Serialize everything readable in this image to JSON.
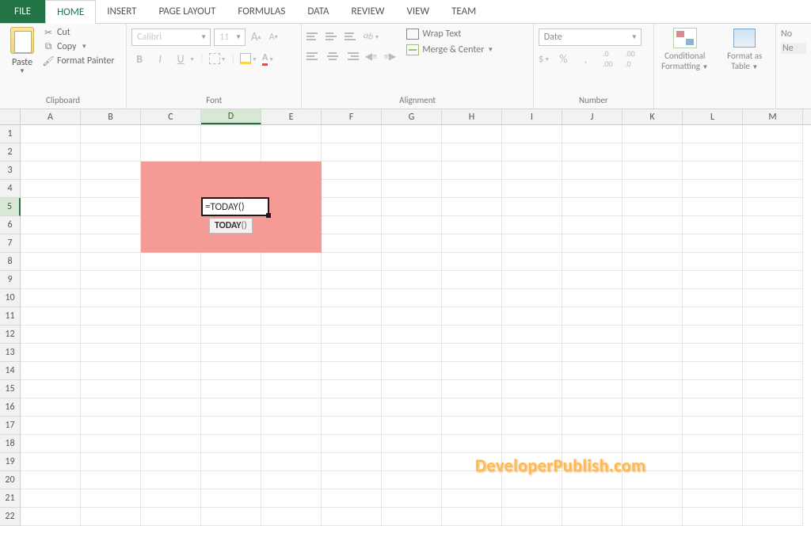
{
  "tabs": {
    "file": "FILE",
    "items": [
      "HOME",
      "INSERT",
      "PAGE LAYOUT",
      "FORMULAS",
      "DATA",
      "REVIEW",
      "VIEW",
      "TEAM"
    ],
    "active": "HOME"
  },
  "clipboard": {
    "group_label": "Clipboard",
    "paste": "Paste",
    "cut": "Cut",
    "copy": "Copy",
    "format_painter": "Format Painter"
  },
  "font": {
    "group_label": "Font",
    "name": "Calibri",
    "size": "11",
    "bold": "B",
    "italic": "I",
    "underline": "U",
    "inc": "A",
    "dec": "A",
    "font_color_letter": "A"
  },
  "alignment": {
    "group_label": "Alignment",
    "wrap": "Wrap Text",
    "merge": "Merge & Center"
  },
  "number": {
    "group_label": "Number",
    "format": "Date",
    "percent": "%",
    "comma": ","
  },
  "styles": {
    "cond": "Conditional Formatting",
    "table": "Format as Table",
    "cells_no": "No",
    "cells_ne": "Ne"
  },
  "columns": [
    "A",
    "B",
    "C",
    "D",
    "E",
    "F",
    "G",
    "H",
    "I",
    "J",
    "K",
    "L",
    "M"
  ],
  "selected_col": "D",
  "rows": [
    1,
    2,
    3,
    4,
    5,
    6,
    7,
    8,
    9,
    10,
    11,
    12,
    13,
    14,
    15,
    16,
    17,
    18,
    19,
    20,
    21,
    22
  ],
  "selected_row": 5,
  "cell_edit": {
    "value": "=TODAY()",
    "tooltip_bold": "TODAY",
    "tooltip_rest": "()"
  },
  "watermark": "DeveloperPublish.com"
}
